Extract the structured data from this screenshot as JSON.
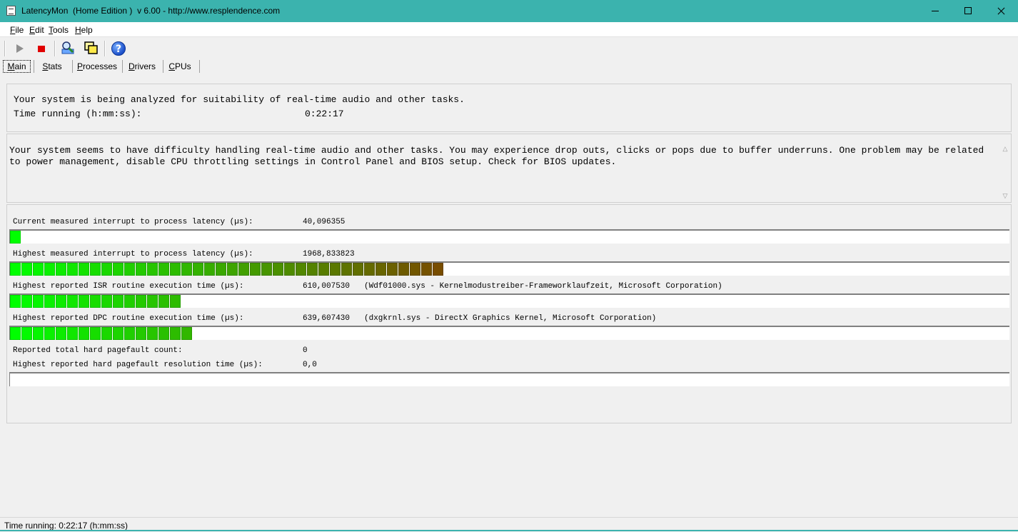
{
  "window": {
    "title": "LatencyMon  (Home Edition )  v 6.00 - http://www.resplendence.com"
  },
  "menu": [
    "File",
    "Edit",
    "Tools",
    "Help"
  ],
  "toolbar": {
    "icons": [
      "play-icon",
      "stop-icon",
      "magnify-icon",
      "windows-icon",
      "help-icon"
    ],
    "help_glyph": "?"
  },
  "tabs": [
    "Main",
    "Stats",
    "Processes",
    "Drivers",
    "CPUs"
  ],
  "summary": {
    "line1": "Your system is being analyzed for suitability of real-time audio and other tasks.",
    "time_label": "Time running (h:mm:ss):",
    "time_value": "0:22:17"
  },
  "message": "Your system seems to have difficulty handling real-time audio and other tasks. You may experience drop outs, clicks or pops due to buffer underruns. One problem may be related to power management, disable CPU throttling settings in Control Panel and BIOS setup. Check for BIOS updates.",
  "metrics": {
    "current_latency": {
      "label": "Current measured interrupt to process latency (µs):",
      "value": "40,096355",
      "level_fraction": 0.01
    },
    "highest_latency": {
      "label": "Highest measured interrupt to process latency (µs):",
      "value": "1968,833823",
      "level_fraction": 0.43
    },
    "isr": {
      "label": "Highest reported ISR routine execution time (µs):",
      "value": "610,007530",
      "extra": "(Wdf01000.sys - Kernelmodustreiber-Frameworklaufzeit, Microsoft Corporation)",
      "level_fraction": 0.17
    },
    "dpc": {
      "label": "Highest reported DPC routine execution time (µs):",
      "value": "639,607430",
      "extra": "(dxgkrnl.sys - DirectX Graphics Kernel, Microsoft Corporation)",
      "level_fraction": 0.18
    },
    "pagefault_count": {
      "label": "Reported total hard pagefault count:",
      "value": "0"
    },
    "pagefault_time": {
      "label": "Highest reported hard pagefault resolution time (µs):",
      "value": "0,0",
      "level_fraction": 0
    }
  },
  "statusbar": {
    "text": "Time running: 0:22:17  (h:mm:ss)"
  },
  "colors": {
    "titlebar": "#3bb3ae",
    "bar_start": "#00ff00",
    "bar_end": "#7a4a00"
  }
}
